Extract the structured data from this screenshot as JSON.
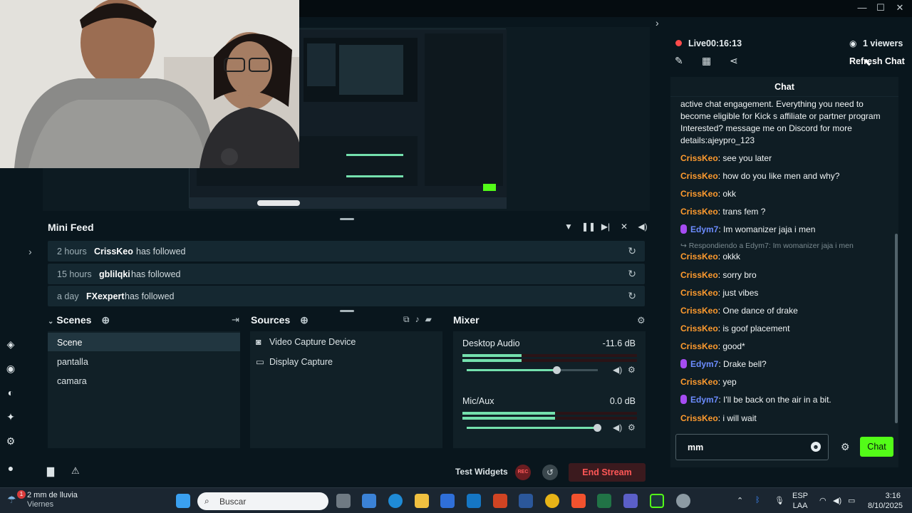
{
  "window": {
    "minimize": "—",
    "maximize": "☐",
    "close": "✕"
  },
  "mini_feed": {
    "title": "Mini Feed",
    "events": [
      {
        "time": "2 hours",
        "user": "CrissKeo",
        "action": "has followed"
      },
      {
        "time": "15 hours",
        "user": "gblilqki",
        "action": "has followed"
      },
      {
        "time": "a day",
        "user": "FXexpert",
        "action": "has followed"
      }
    ]
  },
  "scenes": {
    "title": "Scenes",
    "items": [
      "Scene",
      "pantalla",
      "camara"
    ],
    "active_index": 0
  },
  "sources": {
    "title": "Sources",
    "items": [
      "Video Capture Device",
      "Display Capture"
    ]
  },
  "mixer": {
    "title": "Mixer",
    "channels": [
      {
        "name": "Desktop Audio",
        "db": "-11.6 dB",
        "level": 0.34,
        "volume": 0.69
      },
      {
        "name": "Mic/Aux",
        "db": "0.0 dB",
        "level": 0.53,
        "volume": 1.0
      }
    ]
  },
  "bottom_bar": {
    "test_widgets": "Test Widgets",
    "rec": "REC",
    "end_stream": "End Stream"
  },
  "stream": {
    "live_label": "Live",
    "time": "00:16:13",
    "viewers": "1 viewers",
    "refresh_chat": "Refresh Chat"
  },
  "chat": {
    "title": "Chat",
    "intro": "active chat engagement. Everything you need to become eligible for Kick s affiliate or partner program Interested? message me on Discord for more details:ajeypro_123",
    "messages": [
      {
        "user": "CrissKeo",
        "text": ": see you later"
      },
      {
        "user": "CrissKeo",
        "text": ": how do you like men and why?"
      },
      {
        "user": "CrissKeo",
        "text": ": okk"
      },
      {
        "user": "CrissKeo",
        "text": ": trans fem ?"
      },
      {
        "user": "Edym7",
        "text": ": Im womanizer jaja i men"
      },
      {
        "user": "CrissKeo",
        "text": ": okkk"
      },
      {
        "user": "CrissKeo",
        "text": ": sorry bro"
      },
      {
        "user": "CrissKeo",
        "text": ": just vibes"
      },
      {
        "user": "CrissKeo",
        "text": ": One dance of drake"
      },
      {
        "user": "CrissKeo",
        "text": ": is goof placement"
      },
      {
        "user": "CrissKeo",
        "text": ": good*"
      },
      {
        "user": "Edym7",
        "text": ": Drake bell?"
      },
      {
        "user": "CrissKeo",
        "text": ": yep"
      },
      {
        "user": "Edym7",
        "text": ": I'll be back on the air in a bit."
      },
      {
        "user": "CrissKeo",
        "text": ": i will wait"
      }
    ],
    "reply_note": "↪ Respondiendo a Edym7: Im womanizer jaja i men",
    "input_value": "mm",
    "send_label": "Chat"
  },
  "taskbar": {
    "weather_line1": "2 mm de lluvia",
    "weather_line2": "Viernes",
    "weather_alert": "1",
    "search_placeholder": "Buscar",
    "lang_line1": "ESP",
    "lang_line2": "LAA",
    "time": "3:16",
    "date": "8/10/2025"
  },
  "colors": {
    "accent_green": "#53fc18",
    "end_stream_red": "#ff5757",
    "username_orange": "#ff9b2e",
    "username_blue": "#6c8cff"
  }
}
